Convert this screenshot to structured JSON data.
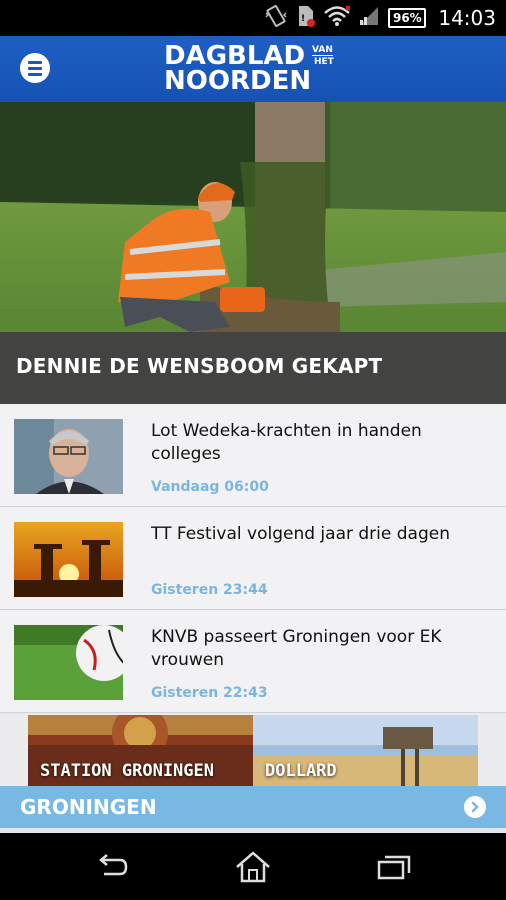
{
  "status_bar": {
    "battery": "96%",
    "time": "14:03",
    "icons": [
      "vibrate-icon",
      "sim-error-icon",
      "wifi-icon",
      "signal-icon",
      "battery-icon"
    ]
  },
  "header": {
    "logo_line1": "DAGBLAD",
    "logo_van": "VAN",
    "logo_het": "HET",
    "logo_line2": "NOORDEN",
    "menu_icon": "menu-icon",
    "brand_color": "#1a56bb"
  },
  "hero": {
    "title": "DENNIE DE WENSBOOM GEKAPT"
  },
  "news": [
    {
      "title": "Lot Wedeka-krachten in handen colleges",
      "time": "Vandaag 06:00",
      "thumb": "portrait-photo"
    },
    {
      "title": "TT Festival volgend jaar drie dagen",
      "time": "Gisteren 23:44",
      "thumb": "sunset-photo"
    },
    {
      "title": "KNVB passeert Groningen voor EK vrouwen",
      "time": "Gisteren 22:43",
      "thumb": "football-photo"
    }
  ],
  "banner": {
    "left_label": "STATION GRONINGEN",
    "right_label": "DOLLARD"
  },
  "section": {
    "title": "GRONINGEN",
    "color": "#7ab8e4",
    "arrow_icon": "chevron-right-icon"
  },
  "navbar": {
    "icons": [
      "back-icon",
      "home-icon",
      "recent-apps-icon"
    ]
  },
  "colors": {
    "time_text": "#7bb5df",
    "list_bg": "#f2f2f4"
  }
}
